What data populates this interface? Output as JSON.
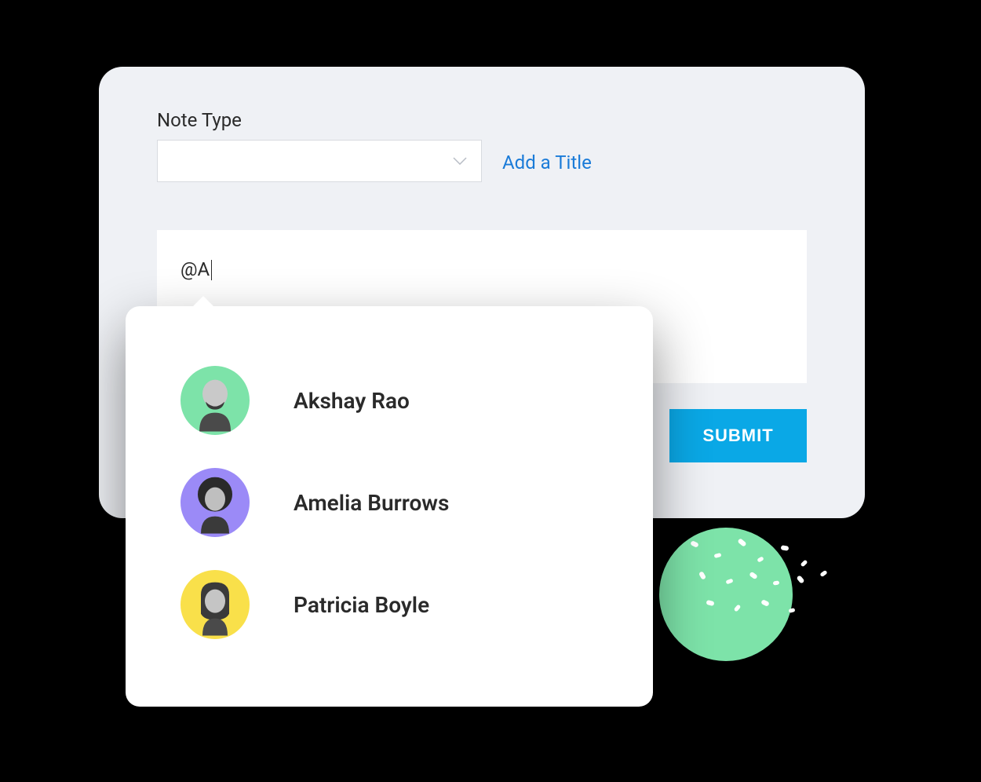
{
  "form": {
    "note_type_label": "Note Type",
    "add_title_link": "Add a Title",
    "textarea_value": "@A",
    "submit_label": "SUBMIT"
  },
  "mentions": {
    "items": [
      {
        "name": "Akshay Rao",
        "avatar_bg": "#7de3a9"
      },
      {
        "name": "Amelia Burrows",
        "avatar_bg": "#9b8af7"
      },
      {
        "name": "Patricia Boyle",
        "avatar_bg": "#f9e04a"
      }
    ]
  },
  "colors": {
    "card_bg": "#eff1f5",
    "accent_blue": "#0aa8e6",
    "link_blue": "#1a7bd8",
    "deco_green": "#7de3a9"
  }
}
